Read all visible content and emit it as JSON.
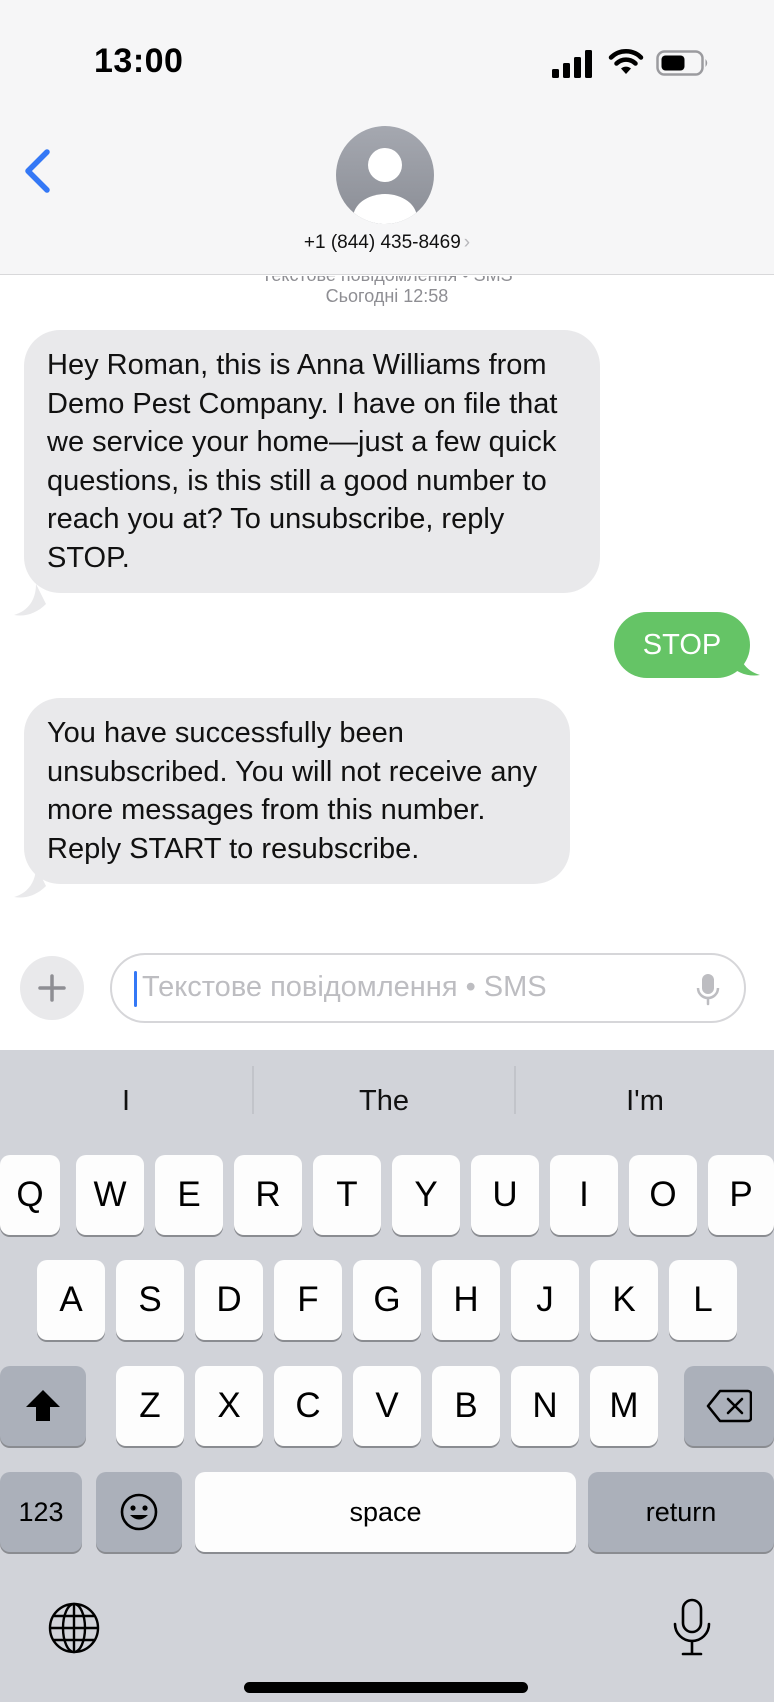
{
  "status_bar": {
    "time": "13:00",
    "icons": [
      "signal-icon",
      "wifi-icon",
      "battery-icon"
    ]
  },
  "header": {
    "back_icon": "chevron-left-icon",
    "avatar_icon": "person-icon",
    "contact": "+1 (844) 435-8469",
    "contact_chevron": "›"
  },
  "thread": {
    "service_label": "Текстове повідомлення • SMS",
    "timestamp": "Сьогодні 12:58",
    "messages": [
      {
        "direction": "incoming",
        "text": "Hey Roman, this is Anna Williams from Demo Pest Company. I have on file that we service your home—just a few quick questions, is this still a good number to reach you at?  To unsubscribe, reply STOP."
      },
      {
        "direction": "outgoing",
        "text": "STOP"
      },
      {
        "direction": "incoming",
        "text": "You have successfully been unsubscribed. You will not receive any more messages from this number. Reply START to resubscribe."
      }
    ]
  },
  "composer": {
    "plus_label": "+",
    "placeholder": "Текстове повідомлення • SMS",
    "mic_icon": "mic-icon"
  },
  "keyboard": {
    "suggestions": [
      "I",
      "The",
      "I'm"
    ],
    "row1": [
      "Q",
      "W",
      "E",
      "R",
      "T",
      "Y",
      "U",
      "I",
      "O",
      "P"
    ],
    "row2": [
      "A",
      "S",
      "D",
      "F",
      "G",
      "H",
      "J",
      "K",
      "L"
    ],
    "row3": [
      "Z",
      "X",
      "C",
      "V",
      "B",
      "N",
      "M"
    ],
    "numbers_key": "123",
    "space_key": "space",
    "return_key": "return",
    "icons": [
      "shift-icon",
      "backspace-icon",
      "emoji-icon",
      "globe-icon",
      "dictation-mic-icon"
    ]
  },
  "colors": {
    "incoming_bubble": "#e9e9eb",
    "outgoing_bubble": "#65c466",
    "accent_blue": "#3478f6",
    "keyboard_bg": "#d1d3d9"
  }
}
